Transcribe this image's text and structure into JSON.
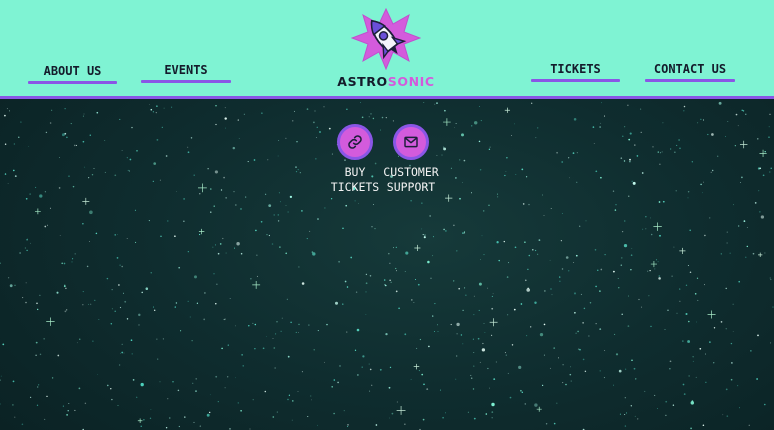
{
  "header": {
    "nav_left": [
      {
        "label": "About Us"
      },
      {
        "label": "Events"
      }
    ],
    "nav_right": [
      {
        "label": "Tickets"
      },
      {
        "label": "Contact Us"
      }
    ],
    "logo": {
      "word_primary": "ASTRO",
      "word_secondary": "SONIC",
      "icon": "rocket-star-icon"
    }
  },
  "actions": [
    {
      "line1": "Buy",
      "line2": "Tickets",
      "icon": "link-icon"
    },
    {
      "line1": "Customer",
      "line2": "Support",
      "icon": "mail-icon"
    }
  ],
  "colors": {
    "header_bg": "#7ff3d3",
    "accent_purple": "#8a56e6",
    "accent_pink": "#d35bdc",
    "text_dark": "#141b2b",
    "space_bg": "#0f2d2f"
  }
}
